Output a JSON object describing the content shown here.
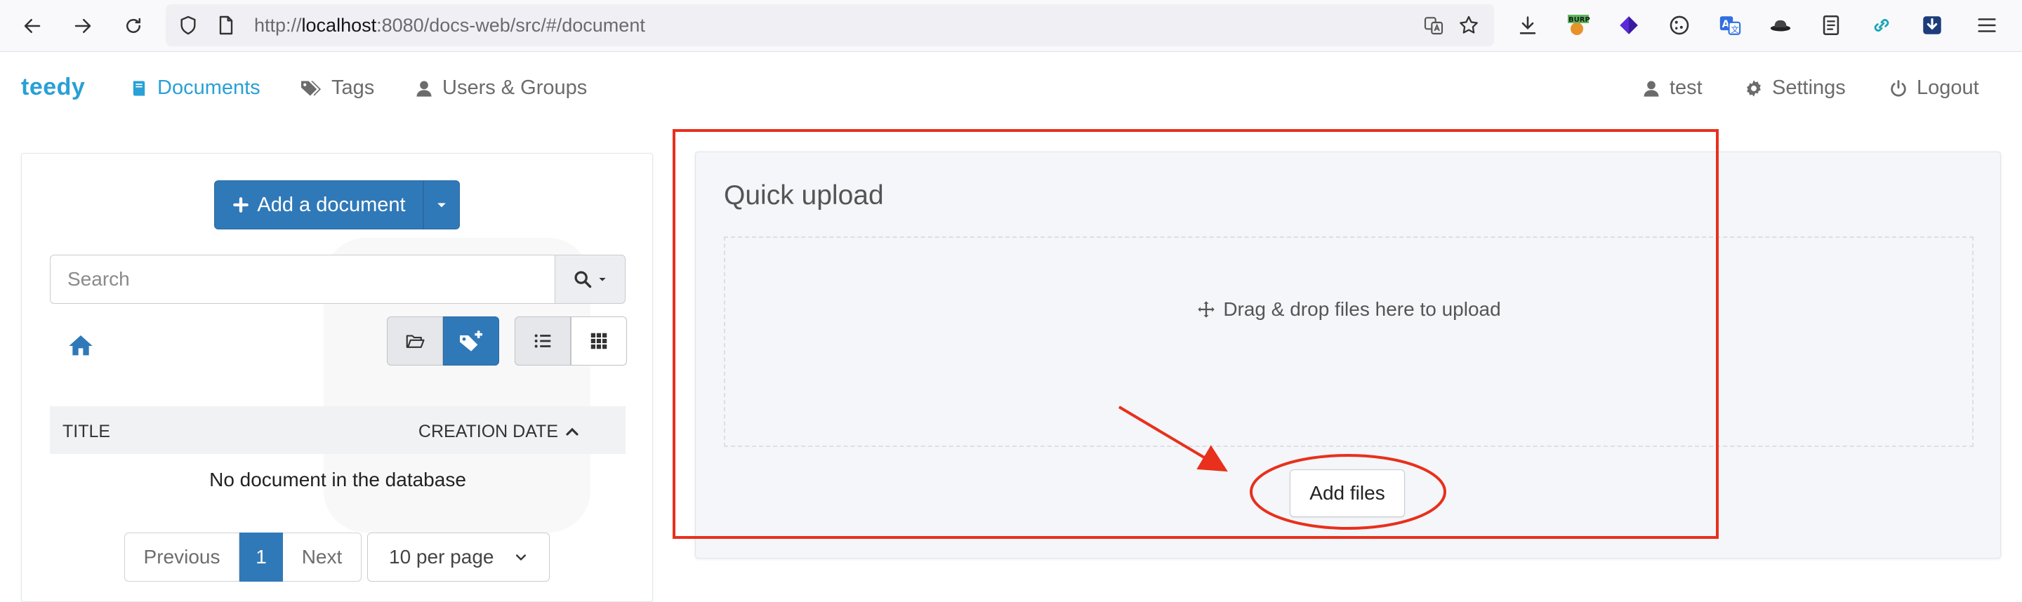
{
  "browser": {
    "url_prefix": "http://",
    "url_host": "localhost",
    "url_rest": ":8080/docs-web/src/#/document",
    "extension_badge": "BURP"
  },
  "navbar": {
    "brand": "teedy",
    "documents": "Documents",
    "tags": "Tags",
    "users_groups": "Users & Groups",
    "user": "test",
    "settings": "Settings",
    "logout": "Logout"
  },
  "left": {
    "add_document": "Add a document",
    "search_placeholder": "Search",
    "col_title": "TITLE",
    "col_date": "CREATION DATE",
    "empty": "No document in the database",
    "pagination": {
      "previous": "Previous",
      "current": "1",
      "next": "Next"
    },
    "per_page": "10 per page"
  },
  "upload": {
    "title": "Quick upload",
    "drop_text": "Drag & drop files here to upload",
    "add_files": "Add files"
  },
  "colors": {
    "brand": "#29a0d6",
    "primary_button": "#3079b8",
    "annotation": "#e8301c"
  }
}
